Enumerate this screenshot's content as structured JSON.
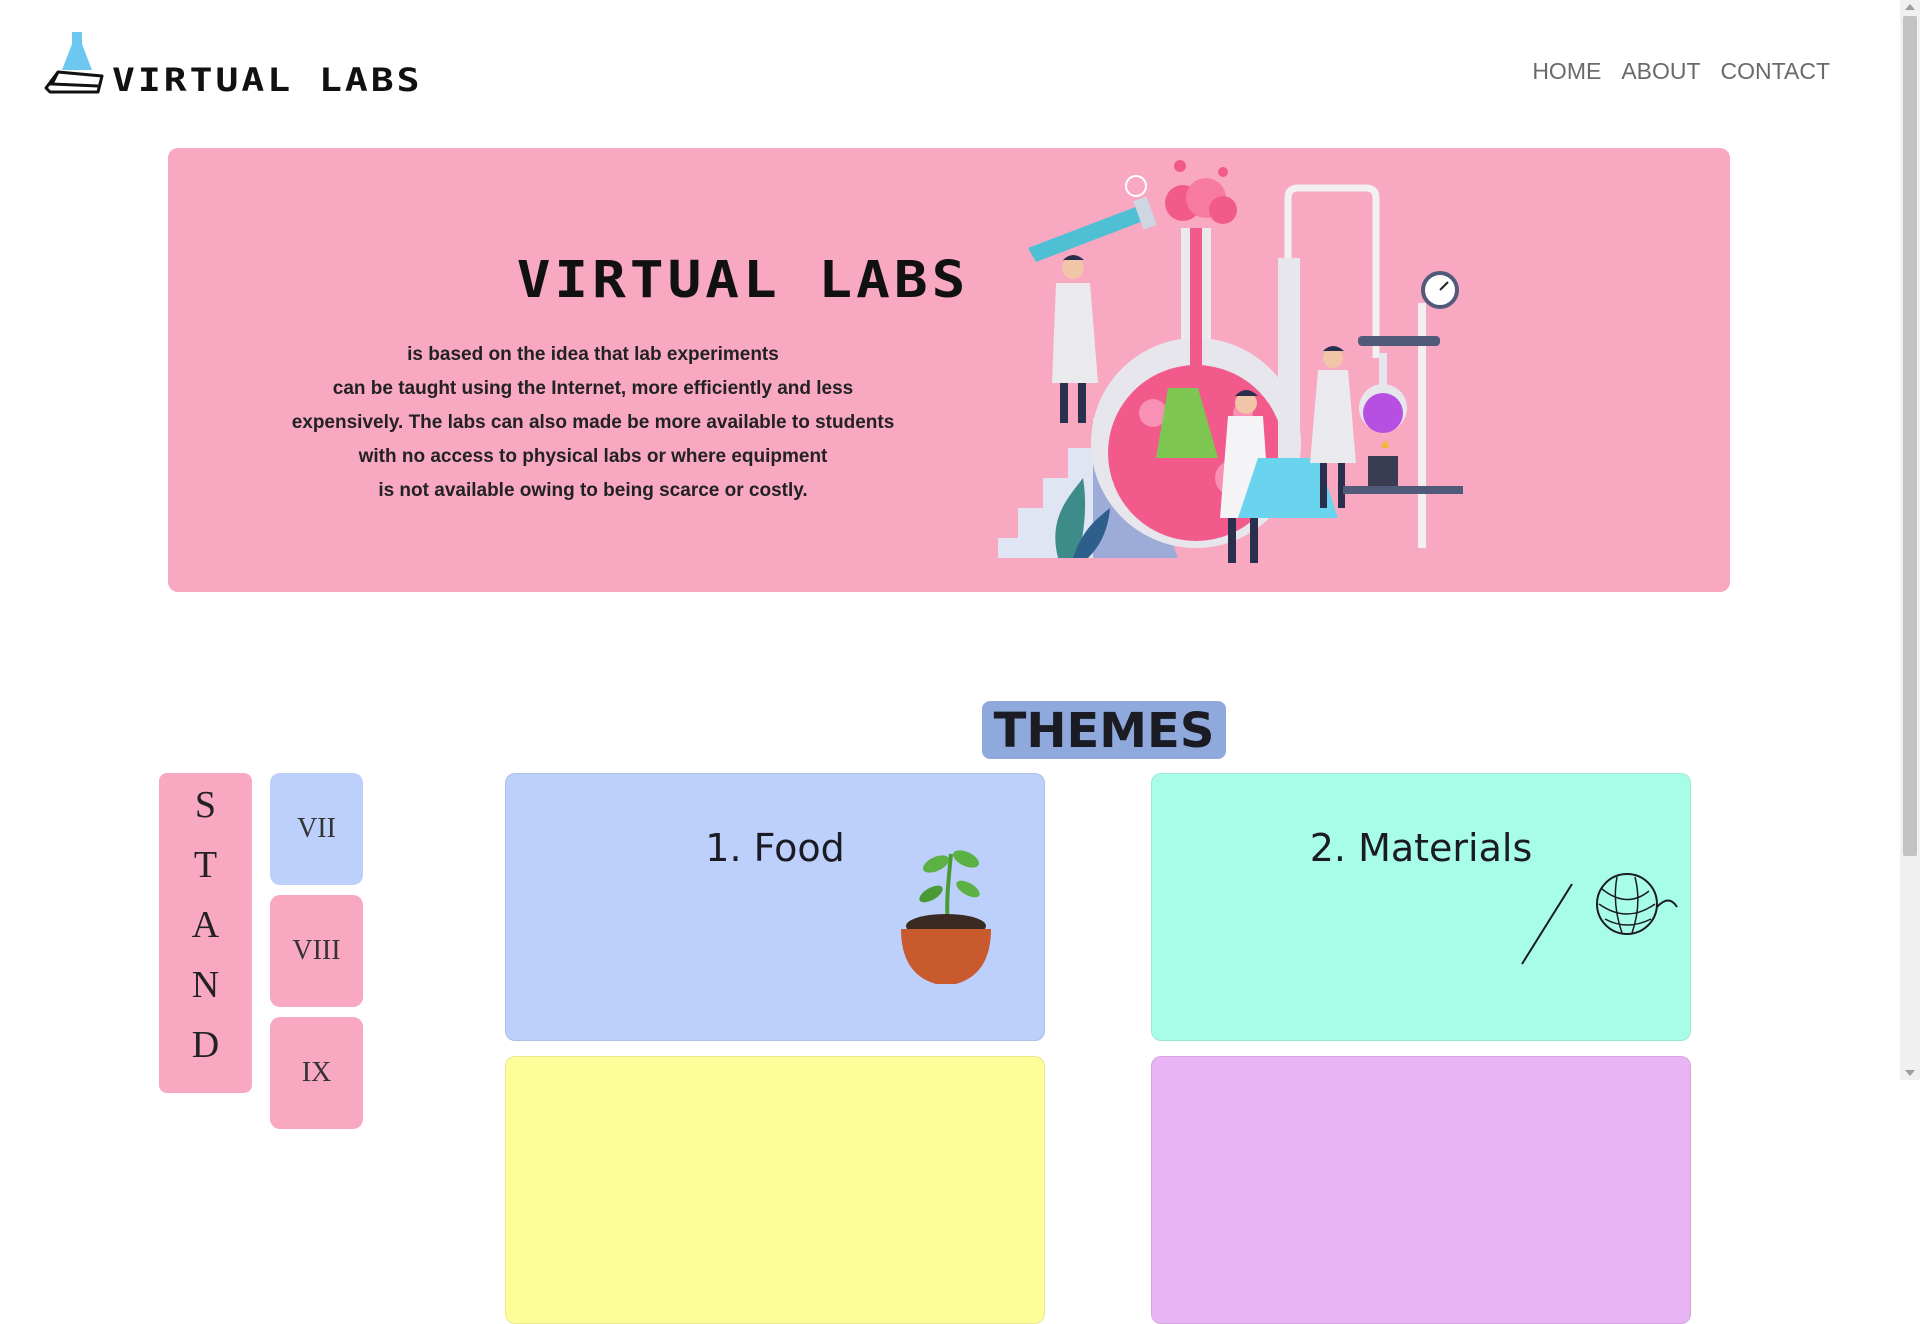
{
  "header": {
    "logo_text": "VIRTUAL LABS",
    "nav": {
      "home": "HOME",
      "about": "ABOUT",
      "contact": "CONTACT"
    }
  },
  "hero": {
    "title": "VIRTUAL LABS",
    "lines": [
      "is based on the idea that lab experiments",
      "can be taught using the Internet, more efficiently and less",
      "expensively. The labs can also made be more available to students",
      "with no access to physical labs or where equipment",
      "is not available owing to being scarce or costly."
    ],
    "illustration_icon": "lab-scientists-illustration"
  },
  "themes": {
    "badge": "THEMES",
    "cards": [
      {
        "title": "1. Food",
        "icon": "plant-pot-icon",
        "color": "#bcd0fb"
      },
      {
        "title": "2. Materials",
        "icon": "yarn-needle-icon",
        "color": "#a8fde9"
      },
      {
        "title": "",
        "color": "#fdfd9a"
      },
      {
        "title": "",
        "color": "#e8b4f3"
      }
    ]
  },
  "standard": {
    "letters": [
      "S",
      "T",
      "A",
      "N",
      "D"
    ],
    "grades": [
      {
        "label": "VII",
        "color": "#bcd0fb"
      },
      {
        "label": "VIII",
        "color": "#f9a8c1"
      },
      {
        "label": "IX",
        "color": "#f9a8c1"
      }
    ]
  },
  "colors": {
    "hero_bg": "#f9a8c1",
    "themes_badge": "#8fa9dc",
    "nav_text": "#6a6a6a"
  }
}
